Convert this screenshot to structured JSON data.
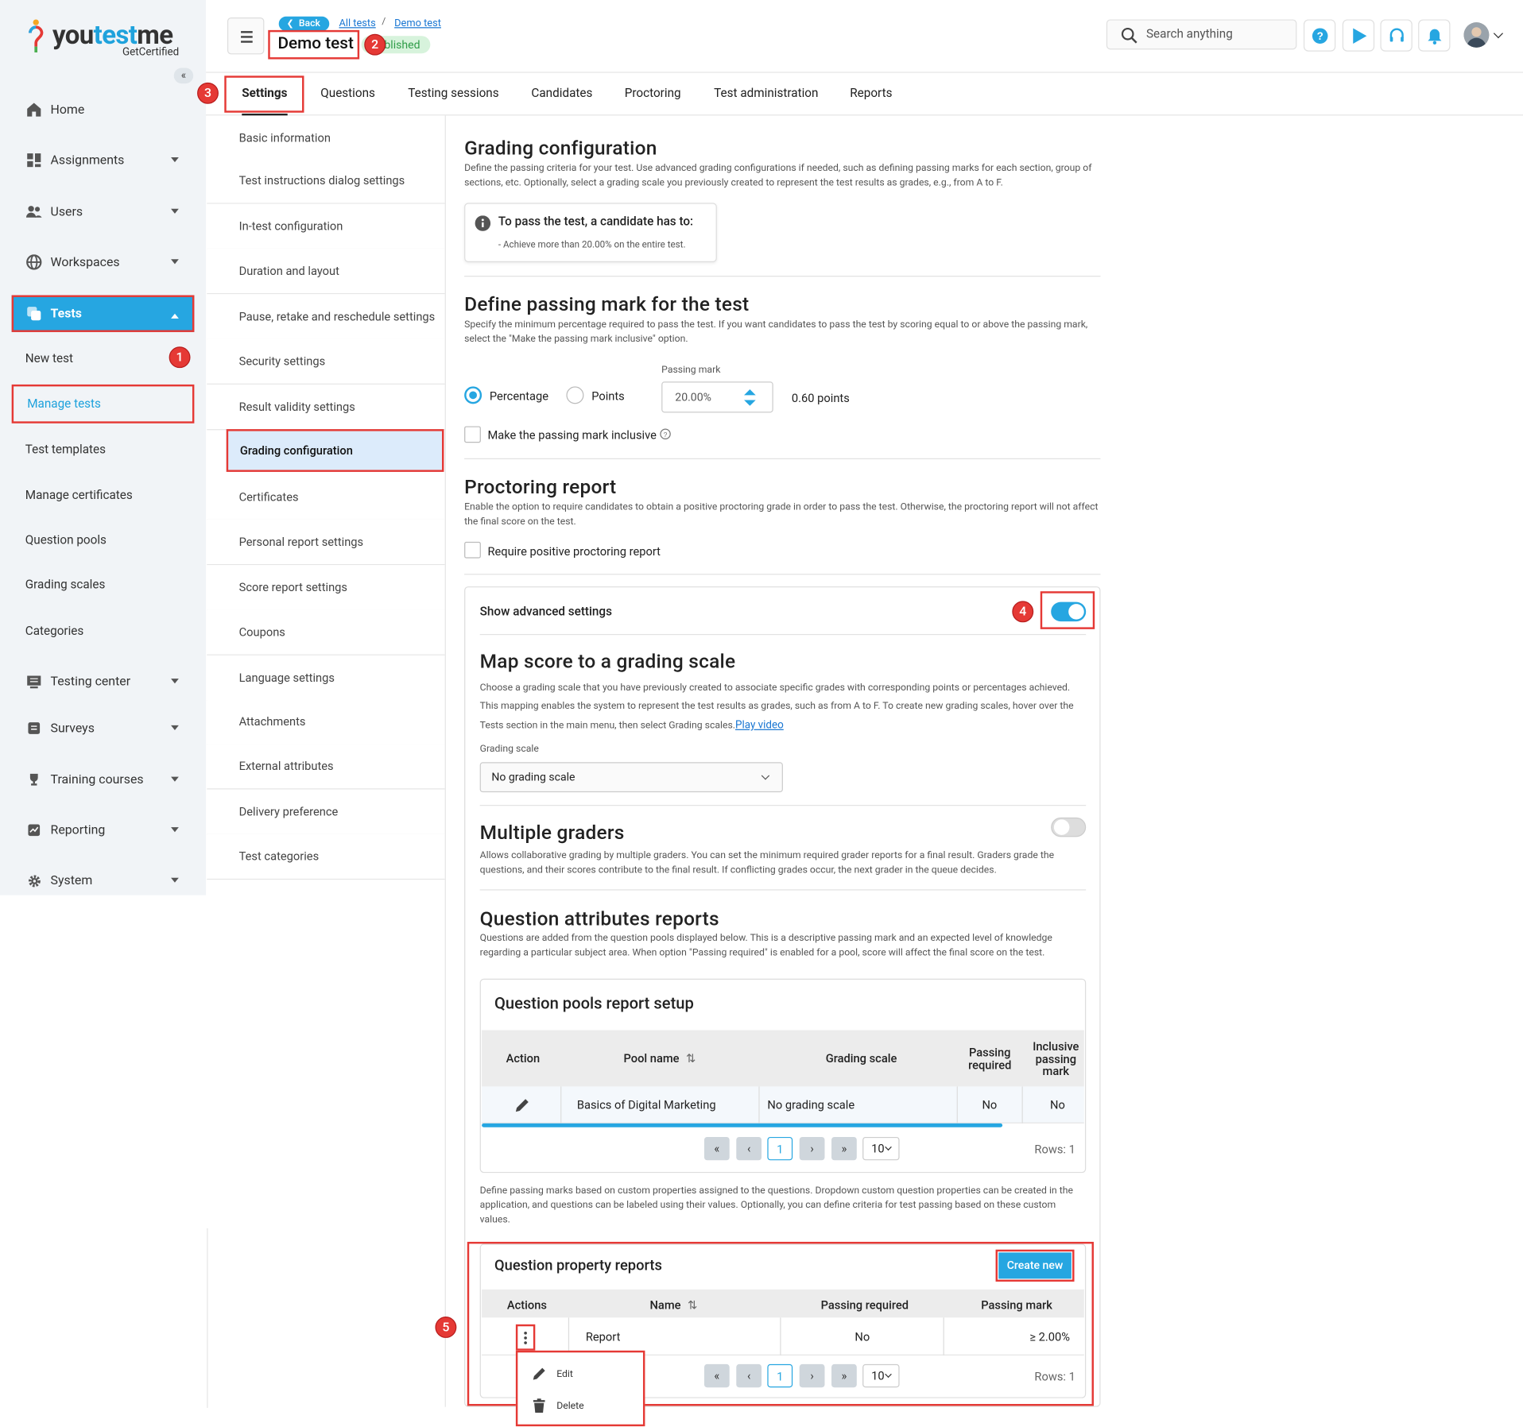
{
  "brand": {
    "name_prefix": "you",
    "name_accent": "test",
    "name_suffix": "me",
    "tagline": "GetCertified"
  },
  "sidebar": {
    "collapse_glyph": "«",
    "items": [
      {
        "label": "Home",
        "icon": "home-icon"
      },
      {
        "label": "Assignments",
        "icon": "assignments-icon"
      },
      {
        "label": "Users",
        "icon": "users-icon"
      },
      {
        "label": "Workspaces",
        "icon": "globe-icon"
      },
      {
        "label": "Tests",
        "icon": "tests-icon"
      },
      {
        "label": "New test"
      },
      {
        "label": "Manage tests"
      },
      {
        "label": "Test templates"
      },
      {
        "label": "Manage certificates"
      },
      {
        "label": "Question pools"
      },
      {
        "label": "Grading scales"
      },
      {
        "label": "Categories"
      },
      {
        "label": "Testing center",
        "icon": "testing-center-icon"
      },
      {
        "label": "Surveys",
        "icon": "surveys-icon"
      },
      {
        "label": "Training courses",
        "icon": "trophy-icon"
      },
      {
        "label": "Reporting",
        "icon": "reporting-icon"
      },
      {
        "label": "System",
        "icon": "gear-icon"
      }
    ]
  },
  "header": {
    "back_label": "Back",
    "breadcrumb": [
      "All tests",
      "Demo test"
    ],
    "breadcrumb_sep": "/",
    "title": "Demo test",
    "status": "Published",
    "search_placeholder": "Search anything"
  },
  "tabs": [
    "Settings",
    "Questions",
    "Testing sessions",
    "Candidates",
    "Proctoring",
    "Test administration",
    "Reports"
  ],
  "settings_menu": [
    "Basic information",
    "Test instructions dialog settings",
    "In-test configuration",
    "Duration and layout",
    "Pause, retake and reschedule settings",
    "Security settings",
    "Result validity settings",
    "Grading configuration",
    "Certificates",
    "Personal report settings",
    "Score report settings",
    "Coupons",
    "Language settings",
    "Attachments",
    "External attributes",
    "Delivery preference",
    "Test categories"
  ],
  "grading": {
    "title": "Grading configuration",
    "desc": "Define the passing criteria for your test. Use advanced grading configurations if needed, such as defining passing marks for each section, group of sections, etc. Optionally, select a grading scale you previously created to represent the test results as grades, e.g., from A to F.",
    "info_title": "To pass the test, a candidate has to:",
    "info_line": "- Achieve more than 20.00% on the entire test."
  },
  "passing": {
    "title": "Define passing mark for the test",
    "desc": "Specify the minimum percentage required to pass the test. If you want candidates to pass the test by scoring equal to or above the passing mark, select the \"Make the passing mark inclusive\" option.",
    "opt_percentage": "Percentage",
    "opt_points": "Points",
    "field_label": "Passing mark",
    "field_value": "20.00%",
    "points_text": "0.60 points",
    "inclusive_label": "Make the passing mark inclusive"
  },
  "proctoring": {
    "title": "Proctoring report",
    "desc": "Enable the option to require candidates to obtain a positive proctoring grade in order to pass the test. Otherwise, the proctoring report will not affect the final score on the test.",
    "checkbox_label": "Require positive proctoring report"
  },
  "advanced": {
    "label": "Show advanced settings",
    "map_title": "Map score to a grading scale",
    "map_desc1": "Choose a grading scale that you have previously created to associate specific grades with corresponding points or percentages achieved.",
    "map_desc2": "This mapping enables the system to represent the test results as grades, such as from A to F. To create new grading scales, hover over the",
    "map_desc3": "Tests section in the main menu, then select Grading scales.",
    "play_video": "Play video",
    "scale_label": "Grading scale",
    "scale_value": "No grading scale",
    "graders_title": "Multiple graders",
    "graders_desc": "Allows collaborative grading by multiple graders. You can set the minimum required grader reports for a final result. Graders grade the questions, and their scores contribute to the final result. If conflicting grades occur, the next grader in the queue decides.",
    "qa_title": "Question attributes reports",
    "qa_desc": "Questions are added from the question pools displayed below. This is a descriptive passing mark and an expected level of knowledge regarding a particular subject area. When option \"Passing required\" is enabled for a pool, score will affect the final score on the test."
  },
  "pools_table": {
    "title": "Question pools report setup",
    "columns": [
      "Action",
      "Pool name",
      "Grading scale",
      "Passing required",
      "Inclusive passing mark"
    ],
    "rows": [
      {
        "pool": "Basics of Digital Marketing",
        "scale": "No grading scale",
        "passing": "No",
        "inclusive": "No"
      }
    ],
    "page": "1",
    "page_size": "10",
    "rows_text": "Rows: 1"
  },
  "property_desc": "Define passing marks based on custom properties assigned to the questions. Dropdown custom question properties can be created in the application, and questions can be labeled using their values. Optionally, you can define criteria for test passing based on these custom values.",
  "property_table": {
    "title": "Question property reports",
    "create_label": "Create new",
    "columns": [
      "Actions",
      "Name",
      "Passing required",
      "Passing mark"
    ],
    "rows": [
      {
        "name": "Report",
        "passing": "No",
        "mark": "≥ 2.00%"
      }
    ],
    "page": "1",
    "page_size": "10",
    "rows_text": "Rows: 1",
    "menu": [
      "Edit",
      "Delete"
    ]
  },
  "step_badges": [
    "1",
    "2",
    "3",
    "4",
    "5"
  ],
  "colors": {
    "accent": "#26a6e1",
    "highlight": "#e53935",
    "active_menu": "#dcebfb"
  }
}
